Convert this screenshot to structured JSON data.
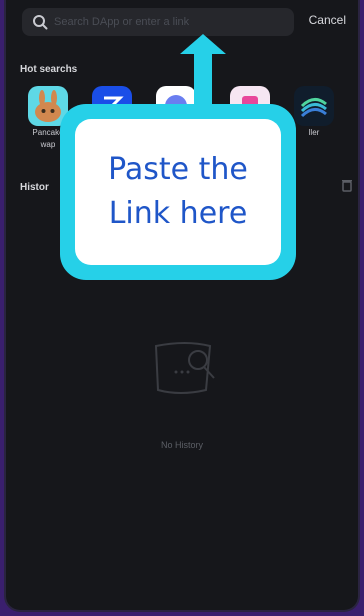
{
  "search": {
    "placeholder": "Search DApp or enter a link",
    "value": ""
  },
  "header": {
    "cancel_label": "Cancel"
  },
  "hot_searches": {
    "title": "Hot searchs",
    "apps": [
      {
        "label_line1": "Pancake",
        "label_line2": "wap",
        "icon": "pancakeswap-bunny-icon"
      },
      {
        "label_line1": "",
        "label_line2": "",
        "icon": "dapp-blue-icon"
      },
      {
        "label_line1": "",
        "label_line2": "",
        "icon": "dapp-purple-icon"
      },
      {
        "label_line1": "",
        "label_line2": "",
        "icon": "dapp-pink-icon"
      },
      {
        "label_line1": "ller",
        "label_line2": "",
        "icon": "dapp-swirl-icon"
      }
    ]
  },
  "history": {
    "title": "Histor",
    "empty_text": "No History"
  },
  "callout": {
    "line1": "Paste the",
    "line2": "Link here"
  },
  "colors": {
    "accent": "#26d0e8",
    "callout_text": "#1f56c8",
    "background": "#16171b",
    "outer": "#3a1f6e"
  }
}
